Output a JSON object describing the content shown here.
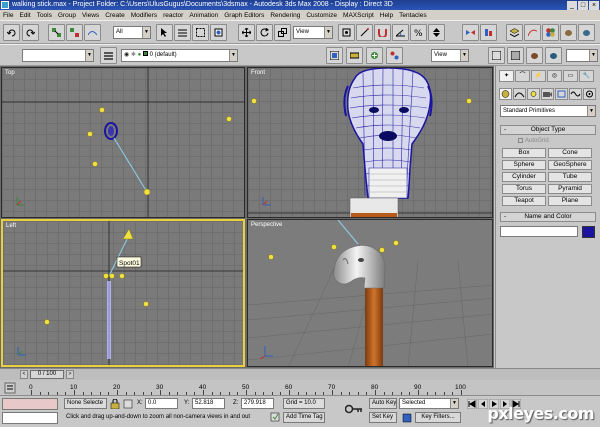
{
  "titlebar": {
    "text": "walking stick.max    - Project Folder: C:\\Users\\UlusGugus\\Documents\\3dsmax       - Autodesk 3ds Max 2008       - Display : Direct 3D",
    "window_buttons": [
      "_",
      "□",
      "×"
    ]
  },
  "menu": [
    "File",
    "Edit",
    "Tools",
    "Group",
    "Views",
    "Create",
    "Modifiers",
    "reactor",
    "Animation",
    "Graph Editors",
    "Rendering",
    "Customize",
    "MAXScript",
    "Help",
    "Tentacles"
  ],
  "toolbar": {
    "selection_filter": "All",
    "reference_coord": "View",
    "named_selection": "View"
  },
  "layer_bar": {
    "layer_name": "0 (default)"
  },
  "viewports": {
    "top": "Top",
    "front": "Front",
    "left": "Left",
    "perspective": "Perspective",
    "light_label": "Spot01"
  },
  "command_panel": {
    "tabs": [
      "✦",
      "⌒",
      "⚡",
      "◎",
      "▭",
      "🔧"
    ],
    "category_select": "Standard Primitives",
    "object_type_title": "Object Type",
    "autogrid_label": "AutoGrid",
    "buttons": [
      "Box",
      "Cone",
      "Sphere",
      "GeoSphere",
      "Cylinder",
      "Tube",
      "Torus",
      "Pyramid",
      "Teapot",
      "Plane"
    ],
    "name_color_title": "Name and Color",
    "rollout_sign": "-"
  },
  "timeline": {
    "frame_display": "0 / 100",
    "ticks": [
      "0",
      "10",
      "20",
      "30",
      "40",
      "50",
      "60",
      "70",
      "80",
      "90",
      "100"
    ],
    "prev_arrow": "<",
    "next_arrow": ">"
  },
  "statusbar": {
    "selection": "None Selecte",
    "prompt": "Click and drag up-and-down to zoom all non-camera views in and out",
    "x_label": "X:",
    "x_value": "0.0",
    "y_label": "Y:",
    "y_value": "52.818",
    "z_label": "Z:",
    "z_value": "279.918",
    "grid": "Grid = 10.0",
    "add_time_tag": "Add Time Tag",
    "auto_key": "Auto Key",
    "auto_key_mode": "Selected",
    "set_key": "Set Key",
    "key_filters": "Key Filters..."
  },
  "watermark": "pxleyes.com",
  "colors": {
    "title_bar": "#2a55b8",
    "active_viewport_border": "#e8d040",
    "wireframe": "#1a14a0",
    "light": "#f0e040",
    "stick_wood": "#b85a1a",
    "silver": "#d8d8d8"
  }
}
